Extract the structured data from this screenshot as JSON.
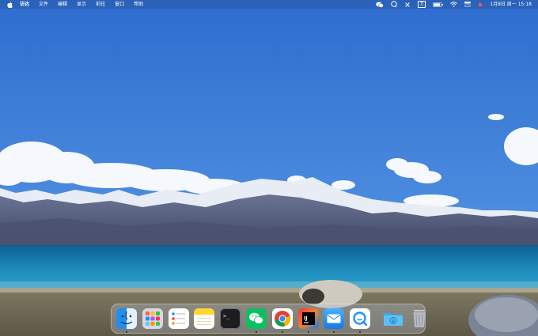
{
  "menubar": {
    "apple_glyph": "",
    "menus": [
      "访达",
      "文件",
      "编辑",
      "显示",
      "前往",
      "窗口",
      "帮助"
    ],
    "status_icons": [
      "wechat-icon",
      "qq-icon",
      "control-icon",
      "input-method-icon",
      "battery-icon",
      "wifi-icon",
      "control-center-icon",
      "siri-icon"
    ],
    "input_method_label": "五",
    "clock": "1月8日 周一  15:18"
  },
  "dock": {
    "apps": [
      {
        "name": "finder",
        "running": true
      },
      {
        "name": "launchpad",
        "running": false
      },
      {
        "name": "reminders",
        "running": false
      },
      {
        "name": "notes",
        "running": false
      },
      {
        "name": "terminal",
        "running": false
      },
      {
        "name": "wechat",
        "running": true
      },
      {
        "name": "chrome",
        "running": true
      },
      {
        "name": "intellij-idea",
        "running": true
      },
      {
        "name": "mail",
        "running": true
      },
      {
        "name": "qq",
        "running": true
      }
    ],
    "stacks": [
      "downloads",
      "trash"
    ],
    "idea_label": "IJ",
    "terminal_label": ">_"
  },
  "colors": {
    "sky_top": "#2f6fcf",
    "sky_bottom": "#6aa0e0",
    "lake": "#1b86b8",
    "mountain": "#55617f",
    "menubar": "#2a5aa8"
  }
}
